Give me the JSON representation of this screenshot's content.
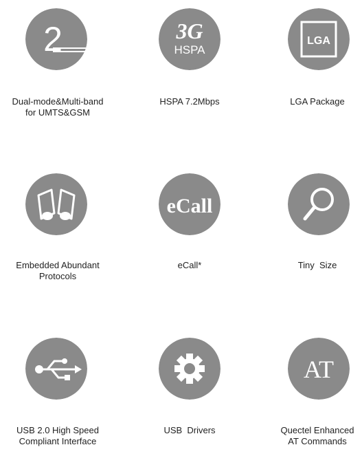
{
  "colors": {
    "circle": "#8a8a8a",
    "icon": "#ffffff",
    "text": "#222222"
  },
  "features": [
    {
      "icon": "digit-two-icon",
      "glyph": "2",
      "label": "Dual-mode&Multi-band\nfor UMTS&GSM"
    },
    {
      "icon": "3g-hspa-icon",
      "glyph": "3G",
      "sub_glyph": "HSPA",
      "label": "HSPA 7.2Mbps"
    },
    {
      "icon": "lga-chip-icon",
      "glyph": "LGA",
      "label": "LGA Package"
    },
    {
      "icon": "open-book-icon",
      "label": "Embedded Abundant\nProtocols"
    },
    {
      "icon": "ecall-icon",
      "glyph": "eCall",
      "label": "eCall*"
    },
    {
      "icon": "magnifier-icon",
      "label": "Tiny  Size"
    },
    {
      "icon": "usb-icon",
      "label": "USB 2.0 High Speed\nCompliant Interface"
    },
    {
      "icon": "gear-icon",
      "label": "USB  Drivers"
    },
    {
      "icon": "at-icon",
      "glyph": "AT",
      "label": "Quectel Enhanced\nAT Commands"
    }
  ]
}
